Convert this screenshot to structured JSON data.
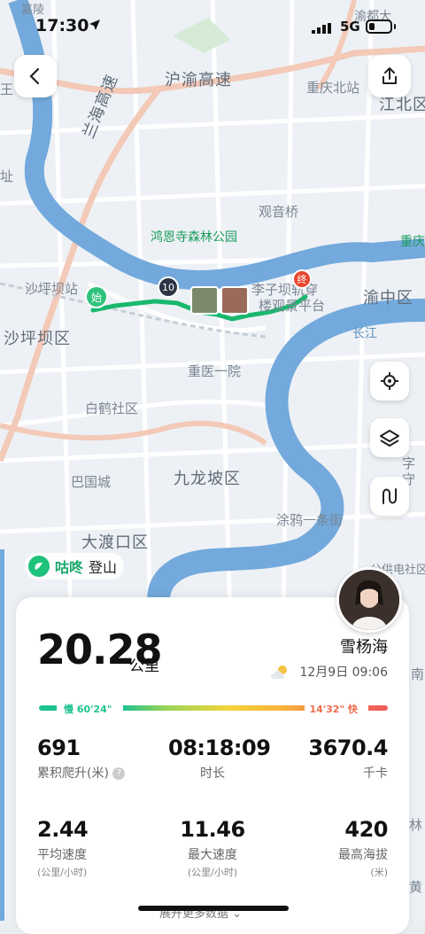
{
  "status": {
    "time": "17:30",
    "network": "5G"
  },
  "map": {
    "labels": {
      "jialing": "嘉陵",
      "yudu": "渝都大",
      "huyu": "沪渝高速",
      "lanhai": "兰海高速",
      "chongqing_north": "重庆北站",
      "jiangbei": "江北区",
      "guanyinqiao": "观音桥",
      "park": "鸿恩寺森林公园",
      "chongqing": "重庆",
      "shapingba_station": "沙坪坝站",
      "shapingba": "沙坪坝区",
      "liziba": "李子坝轨穿",
      "lou_guan": "楼观景平台",
      "yuzhong": "渝中区",
      "changjiang": "长江",
      "zhongyi": "重医一院",
      "baihe": "白鹤社区",
      "bashu": "巴国城",
      "jiulongpo": "九龙坡区",
      "dadukou": "大渡口区",
      "tuya": "涂鸦一条街",
      "wang": "王",
      "zhi": "址",
      "gongying": "公供电社区",
      "zi": "字",
      "shou": "守",
      "lin": "林",
      "huang": "黄",
      "nan": "南"
    },
    "start_marker": "始",
    "end_marker": "终",
    "cluster_count": "10"
  },
  "brand": {
    "name": "咕咚",
    "category": "登山"
  },
  "summary": {
    "distance": "20.28",
    "distance_unit": "公里",
    "username": "雪杨海",
    "datetime": "12月9日 09:06"
  },
  "pace": {
    "slow": "慢 60'24\"",
    "fast": "14'32\" 快"
  },
  "stats": [
    {
      "value": "691",
      "label": "累积爬升(米)"
    },
    {
      "value": "08:18:09",
      "label": "时长"
    },
    {
      "value": "3670.4",
      "label": "千卡"
    },
    {
      "value": "2.44",
      "label": "平均速度",
      "sub": "(公里/小时)"
    },
    {
      "value": "11.46",
      "label": "最大速度",
      "sub": "(公里/小时)"
    },
    {
      "value": "420",
      "label": "最高海拔",
      "sub": "(米)"
    }
  ],
  "more": "展开更多数据",
  "colors": {
    "route": "#19b86e",
    "start": "#2fc27c",
    "end": "#e8462f",
    "river": "#6fa6d9"
  }
}
